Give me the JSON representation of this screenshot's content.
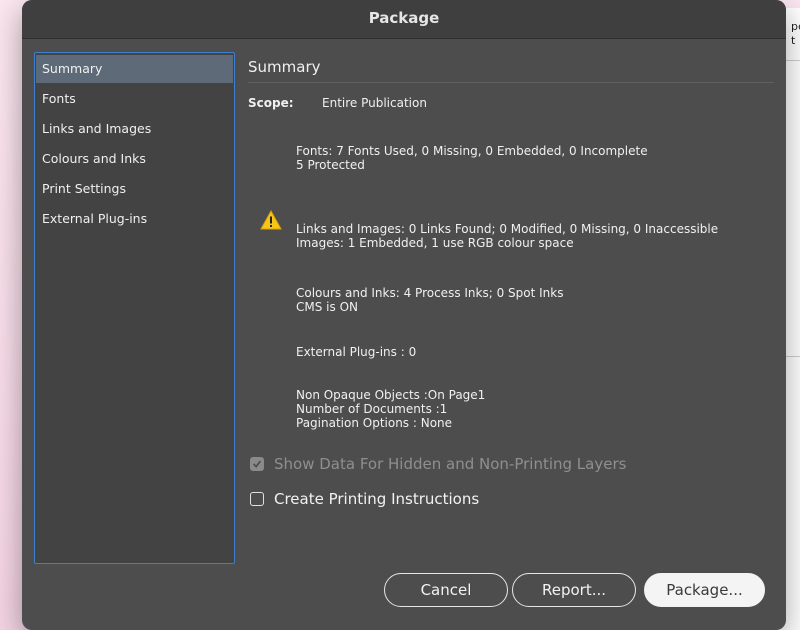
{
  "background": {
    "fragment_line1": "pe",
    "fragment_line2": "t"
  },
  "dialog": {
    "title": "Package"
  },
  "sidebar": {
    "items": [
      {
        "label": "Summary",
        "selected": true
      },
      {
        "label": "Fonts",
        "selected": false
      },
      {
        "label": "Links and Images",
        "selected": false
      },
      {
        "label": "Colours and Inks",
        "selected": false
      },
      {
        "label": "Print Settings",
        "selected": false
      },
      {
        "label": "External Plug-ins",
        "selected": false
      }
    ]
  },
  "summary": {
    "heading": "Summary",
    "scope_label": "Scope:",
    "scope_value": "Entire Publication",
    "fonts": {
      "line1": "Fonts: 7 Fonts Used, 0 Missing, 0 Embedded, 0 Incomplete",
      "line2": "5 Protected"
    },
    "links": {
      "icon": "warning-triangle-icon",
      "line1": "Links and Images: 0 Links Found; 0 Modified, 0 Missing, 0 Inaccessible",
      "line2": "Images: 1 Embedded, 1 use RGB colour space"
    },
    "colours": {
      "line1": "Colours and Inks: 4 Process Inks; 0 Spot Inks",
      "line2": "CMS is ON"
    },
    "plugins": {
      "line1": "External Plug-ins : 0"
    },
    "misc": {
      "line1": "Non Opaque Objects :On Page1",
      "line2": "Number of Documents :1",
      "line3": "Pagination Options : None"
    }
  },
  "options": {
    "show_hidden": {
      "label": "Show Data For Hidden and Non-Printing Layers",
      "checked": true,
      "disabled": true
    },
    "create_instructions": {
      "label": "Create Printing Instructions",
      "checked": false,
      "disabled": false
    }
  },
  "buttons": {
    "cancel": "Cancel",
    "report": "Report...",
    "package": "Package..."
  },
  "colors": {
    "dialog_bg": "#4d4d4d",
    "selection": "#5e6a78",
    "sidebar_border": "#3f7fcf",
    "warning": "#f5c518"
  }
}
